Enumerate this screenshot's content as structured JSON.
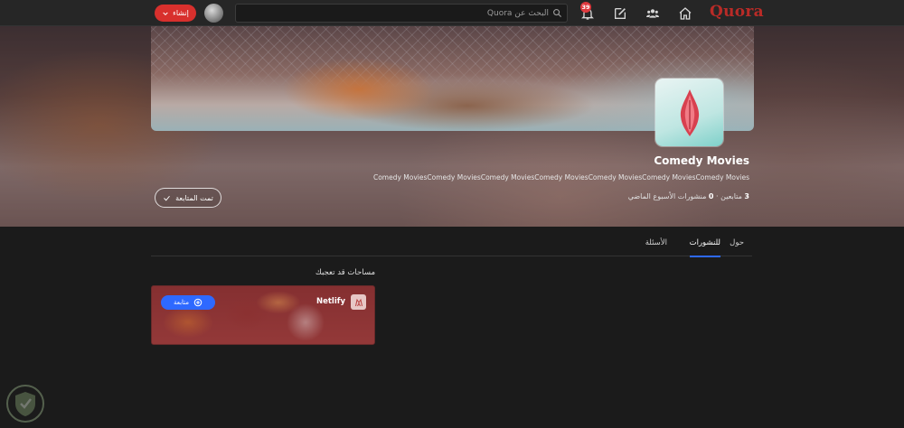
{
  "topbar": {
    "logo": "Quora",
    "notification_count": "39",
    "search_placeholder": "البحث عن Quora",
    "create_label": "إنشاء"
  },
  "space": {
    "title": "Comedy Movies",
    "description": "Comedy MoviesComedy MoviesComedy MoviesComedy MoviesComedy MoviesComedy MoviesComedy Movies",
    "followers_count": "3",
    "followers_label": "متابعين",
    "separator": "·",
    "weekly_posts_count": "0",
    "weekly_posts_label": "منشورات الأسبوع الماضي",
    "follow_label": "تمت المتابعة"
  },
  "tabs": [
    {
      "label": "حول",
      "active": false
    },
    {
      "label": "للنشورات",
      "active": true
    },
    {
      "label": "الأسئلة",
      "active": false
    }
  ],
  "suggestions": {
    "title": "مساحات قد تعجبك",
    "items": [
      {
        "name": "Netlify",
        "follow_label": "متابعة"
      }
    ]
  },
  "colors": {
    "brand": "#b92b27",
    "accent": "#2e69ff",
    "create_button": "#d8302d",
    "background": "#1b1b1b"
  },
  "icons": {
    "nav": [
      "home-icon",
      "users-icon",
      "edit-icon",
      "bell-icon"
    ],
    "search": "search-icon",
    "create": "chevron-down-icon",
    "follow": "check-icon",
    "card_follow": "plus-circle-icon"
  }
}
